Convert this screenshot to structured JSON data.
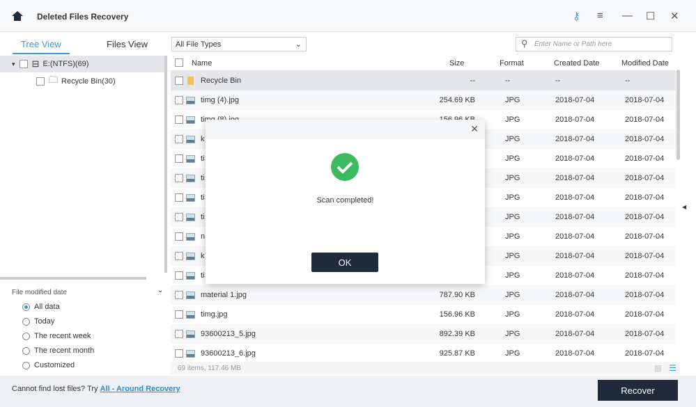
{
  "header": {
    "title": "Deleted Files Recovery"
  },
  "tabs": [
    {
      "label": "Tree View"
    },
    {
      "label": "Files View"
    }
  ],
  "filter_select": {
    "value": "All File Types"
  },
  "search": {
    "placeholder": "Enter Name or Path here"
  },
  "tree": [
    {
      "label": "E:(NTFS)(69)"
    },
    {
      "label": "Recycle Bin(30)"
    }
  ],
  "date_filter": {
    "title": "File modified date",
    "options": [
      "All data",
      "Today",
      "The recent week",
      "The recent month",
      "Customized"
    ],
    "selected": "All data"
  },
  "columns": [
    "Name",
    "Size",
    "Format",
    "Created Date",
    "Modified Date"
  ],
  "rows": [
    {
      "name": "Recycle Bin",
      "size": "--",
      "format": "--",
      "created": "--",
      "modified": "--",
      "folder": true
    },
    {
      "name": "timg (4).jpg",
      "size": "254.69 KB",
      "format": "JPG",
      "created": "2018-07-04",
      "modified": "2018-07-04"
    },
    {
      "name": "timg (8).jpg",
      "size": "156.96 KB",
      "format": "JPG",
      "created": "2018-07-04",
      "modified": "2018-07-04"
    },
    {
      "name": "k",
      "size": "",
      "format": "JPG",
      "created": "2018-07-04",
      "modified": "2018-07-04"
    },
    {
      "name": "ti",
      "size": "",
      "format": "JPG",
      "created": "2018-07-04",
      "modified": "2018-07-04"
    },
    {
      "name": "ti",
      "size": "",
      "format": "JPG",
      "created": "2018-07-04",
      "modified": "2018-07-04"
    },
    {
      "name": "ti",
      "size": "",
      "format": "JPG",
      "created": "2018-07-04",
      "modified": "2018-07-04"
    },
    {
      "name": "ti",
      "size": "",
      "format": "JPG",
      "created": "2018-07-04",
      "modified": "2018-07-04"
    },
    {
      "name": "n",
      "size": "",
      "format": "JPG",
      "created": "2018-07-04",
      "modified": "2018-07-04"
    },
    {
      "name": "k",
      "size": "",
      "format": "JPG",
      "created": "2018-07-04",
      "modified": "2018-07-04"
    },
    {
      "name": "ti",
      "size": "",
      "format": "JPG",
      "created": "2018-07-04",
      "modified": "2018-07-04"
    },
    {
      "name": "material 1.jpg",
      "size": "787.90 KB",
      "format": "JPG",
      "created": "2018-07-04",
      "modified": "2018-07-04"
    },
    {
      "name": "timg.jpg",
      "size": "156.96 KB",
      "format": "JPG",
      "created": "2018-07-04",
      "modified": "2018-07-04"
    },
    {
      "name": "93600213_5.jpg",
      "size": "892.39 KB",
      "format": "JPG",
      "created": "2018-07-04",
      "modified": "2018-07-04"
    },
    {
      "name": "93600213_6.jpg",
      "size": "925.87 KB",
      "format": "JPG",
      "created": "2018-07-04",
      "modified": "2018-07-04"
    }
  ],
  "status": "69 items, 117.46 MB",
  "footer": {
    "hint": "Cannot find lost files? Try ",
    "link": "All - Around Recovery",
    "recover": "Recover"
  },
  "modal": {
    "message": "Scan completed!",
    "ok": "OK"
  },
  "colors": {
    "accent": "#3a9bd5",
    "dark_button": "#1f2a3c",
    "success": "#3dba5f"
  }
}
